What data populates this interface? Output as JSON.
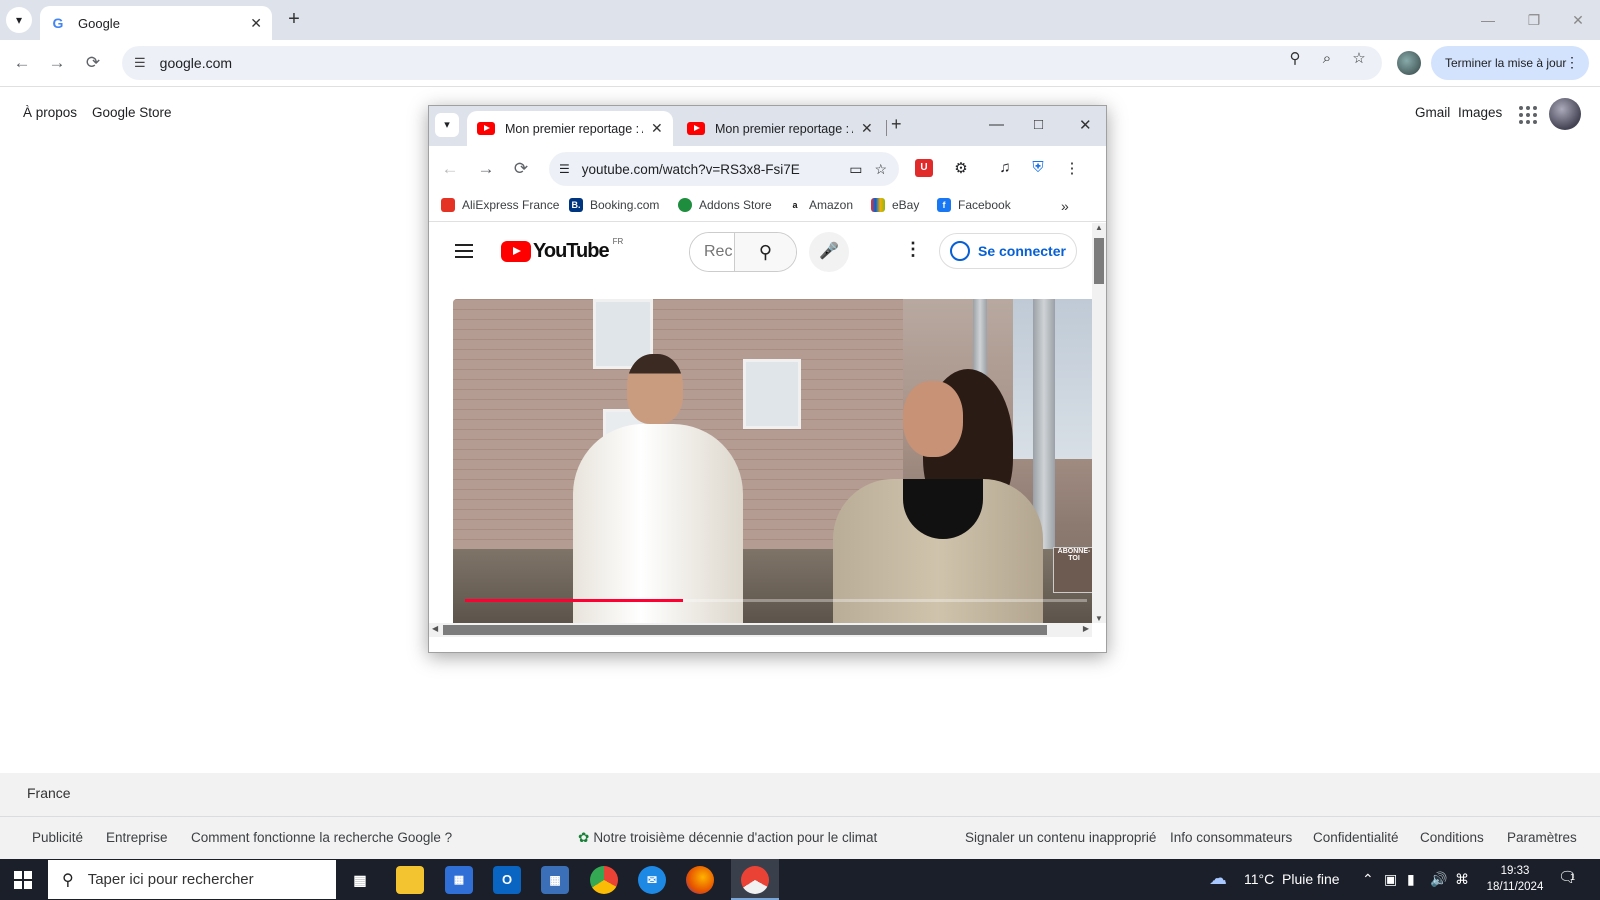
{
  "outer_browser": {
    "tab_title": "Google",
    "url": "google.com",
    "update_button": "Terminer la mise à jour"
  },
  "google": {
    "top_left_links": [
      "À propos",
      "Google Store"
    ],
    "top_right_links": [
      "Gmail",
      "Images"
    ],
    "country": "France",
    "footer_left": [
      "Publicité",
      "Entreprise",
      "Comment fonctionne la recherche Google ?"
    ],
    "footer_center": "Notre troisième décennie d'action pour le climat",
    "footer_right": [
      "Signaler un contenu inapproprié",
      "Info consommateurs",
      "Confidentialité",
      "Conditions",
      "Paramètres"
    ]
  },
  "popup": {
    "tabs": [
      {
        "title": "Mon premier reportage : A",
        "active": true
      },
      {
        "title": "Mon premier reportage : A",
        "active": false
      }
    ],
    "url": "youtube.com/watch?v=RS3x8-Fsi7E",
    "bookmarks": [
      {
        "label": "AliExpress France",
        "color": "#e43225"
      },
      {
        "label": "Booking.com",
        "color": "#003580",
        "glyph": "B."
      },
      {
        "label": "Addons Store",
        "color": "#1e8e3e"
      },
      {
        "label": "Amazon",
        "color": "#111111",
        "glyph": "a"
      },
      {
        "label": "eBay",
        "color": "#e53238"
      },
      {
        "label": "Facebook",
        "color": "#1877f2",
        "glyph": "f"
      }
    ],
    "youtube": {
      "logo_text": "YouTube",
      "region": "FR",
      "search_placeholder": "Rec",
      "signin": "Se connecter"
    },
    "video": {
      "progress": 0.35,
      "badge": "ABONNE-TOI"
    }
  },
  "taskbar": {
    "search_placeholder": "Taper ici pour rechercher",
    "weather_temp": "11°C",
    "weather_desc": "Pluie fine",
    "time": "19:33",
    "date": "18/11/2024",
    "notification_count": "1"
  }
}
